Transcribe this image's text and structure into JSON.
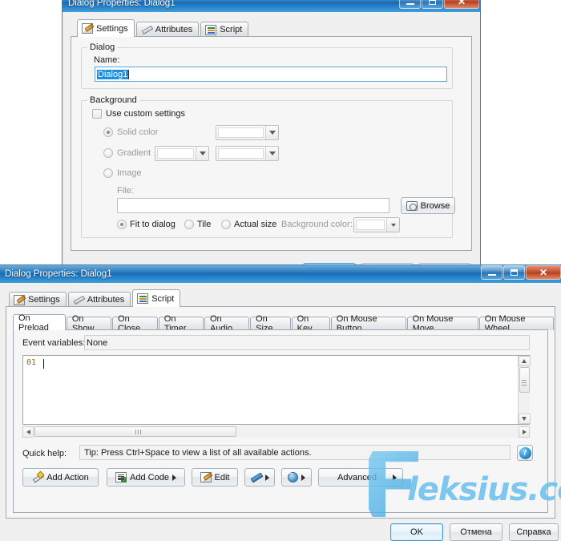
{
  "app": {
    "window_title": "Dialog Properties: Dialog1",
    "window_buttons": {
      "minimize": "minimize-button",
      "maximize": "maximize-button",
      "close": "close-button"
    }
  },
  "settings_window": {
    "title": "Dialog Properties: Dialog1",
    "tabs": [
      {
        "label": "Settings",
        "icon": "settings-icon",
        "active": true
      },
      {
        "label": "Attributes",
        "icon": "attributes-icon",
        "active": false
      },
      {
        "label": "Script",
        "icon": "script-icon",
        "active": false
      }
    ],
    "dialog_group": {
      "legend": "Dialog",
      "name_label": "Name:",
      "name_value": "Dialog1"
    },
    "background_group": {
      "legend": "Background",
      "use_custom_label": "Use custom settings",
      "use_custom_checked": false,
      "solid_color_label": "Solid color",
      "solid_color_selected": true,
      "gradient_label": "Gradient",
      "gradient_selected": false,
      "image_label": "Image",
      "image_selected": false,
      "file_label": "File:",
      "file_value": "",
      "browse_label": "Browse",
      "fit_to_dialog_label": "Fit to dialog",
      "fit_to_dialog_selected": true,
      "tile_label": "Tile",
      "tile_selected": false,
      "actual_size_label": "Actual size",
      "actual_size_selected": false,
      "background_color_label": "Background color:"
    },
    "footer": {
      "ok": "OK",
      "cancel": "Отмена",
      "help": "Справка"
    }
  },
  "script_window": {
    "title": "Dialog Properties: Dialog1",
    "tabs": [
      {
        "label": "Settings",
        "icon": "settings-icon",
        "active": false
      },
      {
        "label": "Attributes",
        "icon": "attributes-icon",
        "active": false
      },
      {
        "label": "Script",
        "icon": "script-icon",
        "active": true
      }
    ],
    "event_tabs": [
      {
        "label": "On Preload",
        "active": true
      },
      {
        "label": "On Show",
        "active": false
      },
      {
        "label": "On Close",
        "active": false
      },
      {
        "label": "On Timer",
        "active": false
      },
      {
        "label": "On Audio",
        "active": false
      },
      {
        "label": "On Size",
        "active": false
      },
      {
        "label": "On Key",
        "active": false
      },
      {
        "label": "On Mouse Button",
        "active": false
      },
      {
        "label": "On Mouse Move",
        "active": false
      },
      {
        "label": "On Mouse Wheel",
        "active": false
      }
    ],
    "event_variables_label": "Event variables:",
    "event_variables_value": "None",
    "editor": {
      "line_number": "01",
      "line_text": ""
    },
    "quick_help_label": "Quick help:",
    "quick_help_value": "Tip: Press Ctrl+Space to view a list of all available actions.",
    "toolbar": [
      {
        "label": "Add Action",
        "icon": "magic-wand-icon",
        "dropdown": false
      },
      {
        "label": "Add Code",
        "icon": "add-code-icon",
        "dropdown": true
      },
      {
        "label": "Edit",
        "icon": "edit-icon",
        "dropdown": false
      },
      {
        "label": "",
        "icon": "pen-icon",
        "dropdown": true
      },
      {
        "label": "",
        "icon": "globe-icon",
        "dropdown": true
      },
      {
        "label": "Advanced",
        "icon": "",
        "dropdown": true
      }
    ],
    "help_button_glyph": "?",
    "footer": {
      "ok": "OK",
      "cancel": "Отмена",
      "help": "Справка"
    }
  },
  "watermark": {
    "text": "leksius.com"
  },
  "colors": {
    "titlebar_blue": "#1e72ba",
    "close_red": "#c2482a",
    "selection_blue": "#1a8fe0",
    "accent_focus": "#5fa8d9",
    "watermark": "#5ab9eb"
  }
}
